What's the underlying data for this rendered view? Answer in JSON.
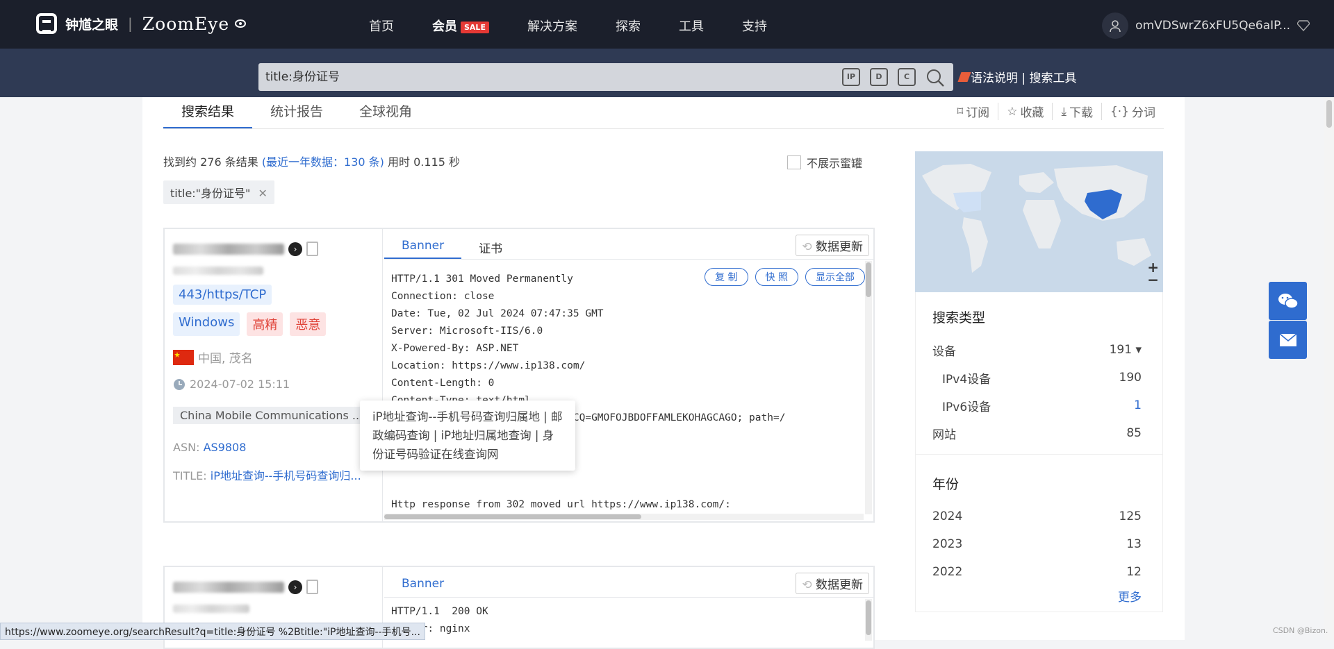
{
  "header": {
    "logo_cn": "钟馗之眼",
    "logo_sep": "|",
    "logo_en": "ZoomEye",
    "nav": [
      {
        "label": "首页"
      },
      {
        "label": "会员",
        "badge": "SALE"
      },
      {
        "label": "解决方案"
      },
      {
        "label": "探索"
      },
      {
        "label": "工具"
      },
      {
        "label": "支持"
      }
    ],
    "username": "omVDSwrZ6xFU5Qe6aIP..."
  },
  "search": {
    "query": "title:身份证号",
    "icons": [
      "IP",
      "D",
      "C"
    ],
    "syntax_link": "语法说明",
    "divider": "|",
    "tools_link": "搜索工具"
  },
  "tabs": [
    "搜索结果",
    "统计报告",
    "全球视角"
  ],
  "actions": [
    "订阅",
    "收藏",
    "下载",
    "分词"
  ],
  "summary": {
    "prefix": "找到约 276 条结果",
    "recent": "(最近一年数据：130 条)",
    "time": "用时 0.115 秒"
  },
  "no_honeypot": "不展示蜜罐",
  "filter_tag": "title:\"身份证号\"",
  "result1": {
    "port": "443/https/TCP",
    "os": "Windows",
    "badges": [
      "高精",
      "恶意"
    ],
    "location": "中国, 茂名",
    "time": "2024-07-02 15:11",
    "org": "China Mobile Communications ...",
    "asn_label": "ASN:",
    "asn": "AS9808",
    "title_label": "TITLE:",
    "title": "iP地址查询--手机号码查询归...",
    "tabs": [
      "Banner",
      "证书"
    ],
    "update": "数据更新",
    "buttons": [
      "复 制",
      "快 照",
      "显示全部"
    ],
    "banner": "HTTP/1.1 301 Moved Permanently\nConnection: close\nDate: Tue, 02 Jul 2024 07:47:35 GMT\nServer: Microsoft-IIS/6.0\nX-Powered-By: ASP.NET\nLocation: https://www.ip138.com/\nContent-Length: 0\nContent-Type: text/html\nSet-Cookie: ASPSESSIONIDQSCQCQCQ=GMOFOJBDOFFAMLEKOHAGCAGO; path=/\nCache-control: private\n\n\n\nHttp response from 302 moved url https://www.ip138.com/:"
  },
  "tooltip": "iP地址查询--手机号码查询归属地 | 邮政编码查询 | iP地址归属地查询 | 身份证号码验证在线查询网",
  "result2": {
    "tabs": [
      "Banner"
    ],
    "update": "数据更新",
    "banner": "HTTP/1.1  200 OK\nServer: nginx"
  },
  "sidebar": {
    "map_zoom_in": "+",
    "map_zoom_out": "−",
    "search_type": {
      "title": "搜索类型",
      "rows": [
        {
          "label": "设备",
          "count": "191 ▾"
        },
        {
          "label": "IPv4设备",
          "count": "190",
          "sub": true
        },
        {
          "label": "IPv6设备",
          "count": "1",
          "sub": true,
          "blue": true
        },
        {
          "label": "网站",
          "count": "85"
        }
      ]
    },
    "year": {
      "title": "年份",
      "rows": [
        {
          "label": "2024",
          "count": "125"
        },
        {
          "label": "2023",
          "count": "13"
        },
        {
          "label": "2022",
          "count": "12"
        }
      ],
      "more": "更多"
    }
  },
  "statusbar": "https://www.zoomeye.org/searchResult?q=title:身份证号 %2Btitle:\"iP地址查询--手机号...",
  "watermark": "CSDN @Bizon.",
  "colors": {
    "primary": "#2f6ccf",
    "topbar": "#1b1f2b",
    "searchbar": "#2f3a54",
    "danger": "#e0443a"
  }
}
